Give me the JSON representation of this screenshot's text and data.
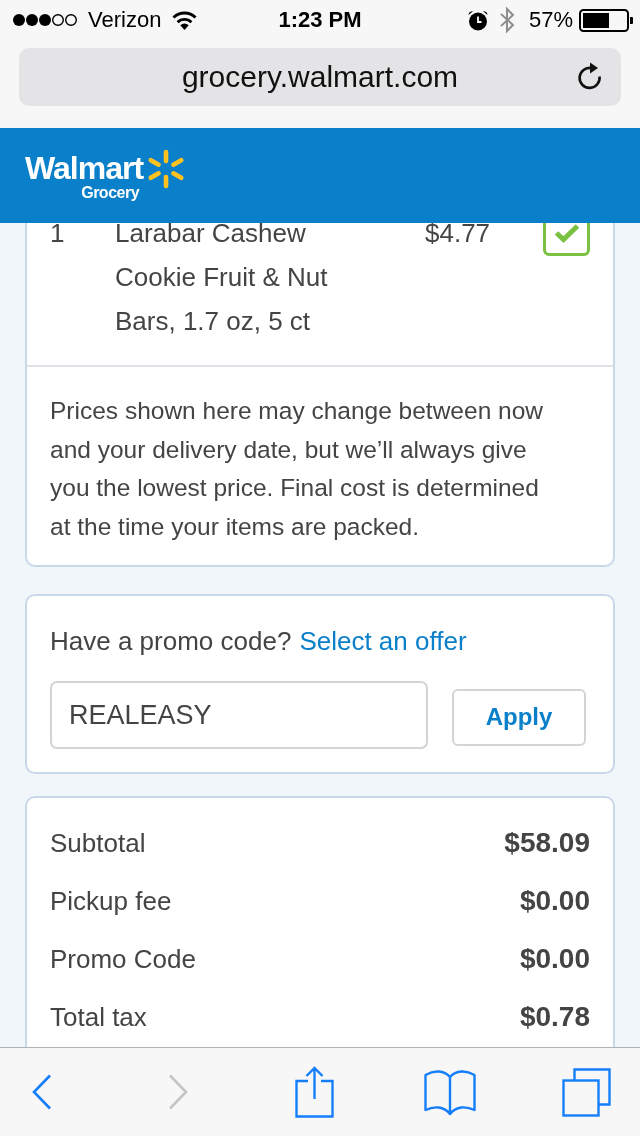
{
  "status_bar": {
    "carrier": "Verizon",
    "time": "1:23 PM",
    "battery": "57%"
  },
  "address_bar": {
    "url": "grocery.walmart.com"
  },
  "header": {
    "logo": "Walmart",
    "logo_sub": "Grocery"
  },
  "cart_item": {
    "quantity": "1",
    "name": "Larabar Cashew Cookie Fruit & Nut Bars, 1.7 oz, 5 ct",
    "price": "$4.77",
    "checked": true
  },
  "price_notice": "Prices shown here may change between now and your delivery date, but we’ll always give you the lowest price. Final cost is determined at the time your items are packed.",
  "promo": {
    "prompt": "Have a promo code?",
    "link": "Select an offer",
    "value": "REALEASY",
    "button": "Apply"
  },
  "summary": [
    {
      "label": "Subtotal",
      "amount": "$58.09"
    },
    {
      "label": "Pickup fee",
      "amount": "$0.00"
    },
    {
      "label": "Promo Code",
      "amount": "$0.00"
    },
    {
      "label": "Total tax",
      "amount": "$0.78"
    }
  ],
  "toolbar": [
    {
      "kind": "back",
      "disabled": false
    },
    {
      "kind": "forward",
      "disabled": true
    },
    {
      "kind": "share",
      "disabled": false
    },
    {
      "kind": "bookmarks",
      "disabled": false
    },
    {
      "kind": "tabs",
      "disabled": false
    }
  ]
}
